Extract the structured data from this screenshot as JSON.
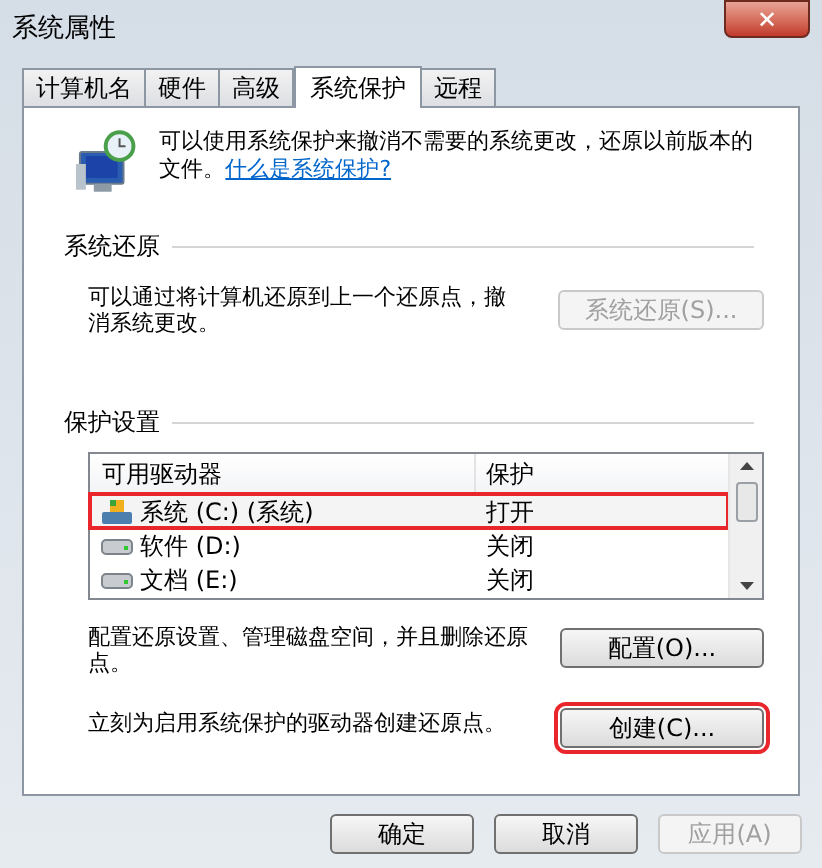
{
  "window": {
    "title": "系统属性",
    "close": "✕"
  },
  "tabs": [
    {
      "label": "计算机名",
      "selected": false
    },
    {
      "label": "硬件",
      "selected": false
    },
    {
      "label": "高级",
      "selected": false
    },
    {
      "label": "系统保护",
      "selected": true
    },
    {
      "label": "远程",
      "selected": false
    }
  ],
  "intro": {
    "text": "可以使用系统保护来撤消不需要的系统更改，还原以前版本的文件。",
    "link": "什么是系统保护?"
  },
  "restore": {
    "heading": "系统还原",
    "text": "可以通过将计算机还原到上一个还原点，撤消系统更改。",
    "button": {
      "label": "系统还原(S)...",
      "disabled": true
    }
  },
  "protection": {
    "heading": "保护设置",
    "table": {
      "columns": [
        "可用驱动器",
        "保护"
      ],
      "rows": [
        {
          "drive": "系统 (C:) (系统)",
          "protection": "打开",
          "kind": "system",
          "annotated": true
        },
        {
          "drive": "软件 (D:)",
          "protection": "关闭",
          "kind": "disk",
          "annotated": false
        },
        {
          "drive": "文档 (E:)",
          "protection": "关闭",
          "kind": "disk",
          "annotated": false
        }
      ]
    },
    "actions": [
      {
        "text": "配置还原设置、管理磁盘空间，并且删除还原点。",
        "button": "配置(O)...",
        "annotated": false
      },
      {
        "text": "立刻为启用系统保护的驱动器创建还原点。",
        "button": "创建(C)...",
        "annotated": true
      }
    ]
  },
  "buttons": [
    {
      "label": "确定",
      "disabled": false
    },
    {
      "label": "取消",
      "disabled": false
    },
    {
      "label": "应用(A)",
      "disabled": true
    }
  ]
}
